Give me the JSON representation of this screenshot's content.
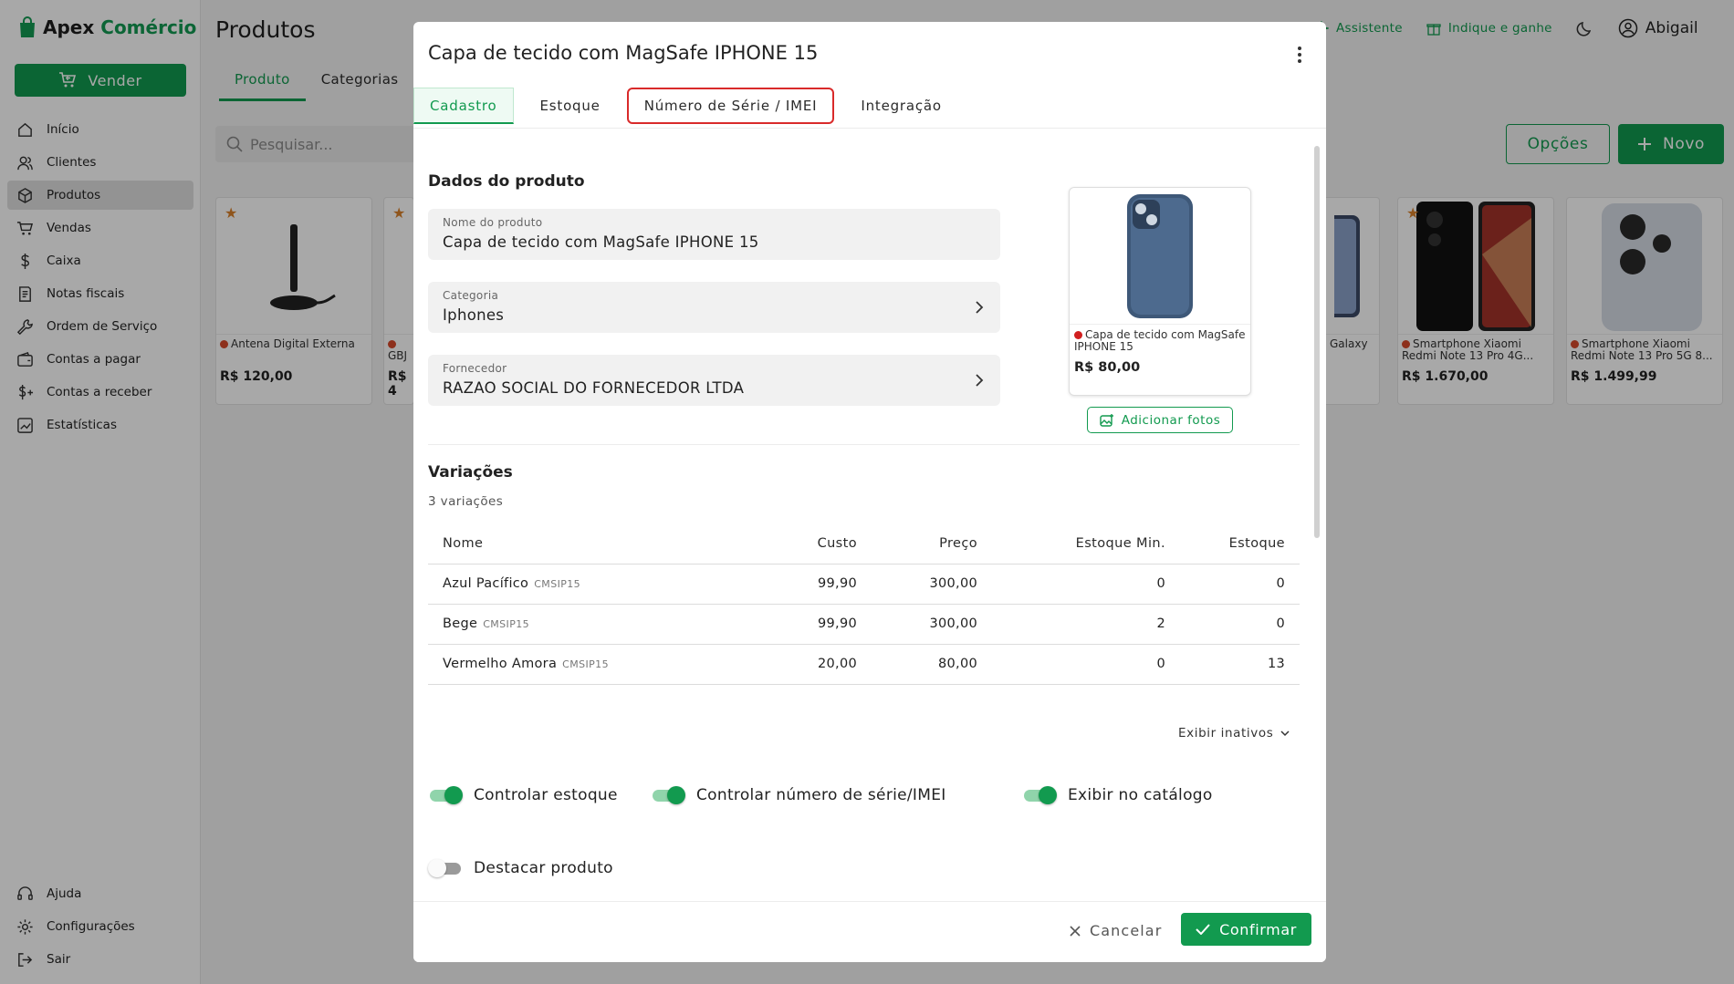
{
  "app": {
    "brand_part1": "Apex",
    "brand_part2": "Comércio",
    "sell_label": "Vender"
  },
  "sidebar": {
    "items": [
      {
        "label": "Início",
        "icon": "home-icon"
      },
      {
        "label": "Clientes",
        "icon": "users-icon"
      },
      {
        "label": "Produtos",
        "icon": "box-icon",
        "active": true
      },
      {
        "label": "Vendas",
        "icon": "cart-icon"
      },
      {
        "label": "Caixa",
        "icon": "dollar-icon"
      },
      {
        "label": "Notas fiscais",
        "icon": "receipt-icon"
      },
      {
        "label": "Ordem de Serviço",
        "icon": "wrench-icon"
      },
      {
        "label": "Contas a pagar",
        "icon": "wallet-icon"
      },
      {
        "label": "Contas a receber",
        "icon": "dollar-plus-icon"
      },
      {
        "label": "Estatísticas",
        "icon": "chart-icon"
      }
    ],
    "bottom": [
      {
        "label": "Ajuda",
        "icon": "headset-icon"
      },
      {
        "label": "Configurações",
        "icon": "gear-icon"
      },
      {
        "label": "Sair",
        "icon": "logout-icon"
      }
    ]
  },
  "header": {
    "title": "Produtos",
    "tabs": [
      "Produto",
      "Categorias"
    ],
    "search_placeholder": "Pesquisar...",
    "assistant": "Assistente",
    "refer": "Indique e ganhe",
    "user": "Abigail",
    "options": "Opções",
    "new": "Novo"
  },
  "products": [
    {
      "name": "Antena Digital Externa",
      "price": "R$ 120,00"
    },
    {
      "name": "GBJ",
      "price": "R$ 4"
    },
    {
      "name": "Galaxy",
      "price": ""
    },
    {
      "name": "Smartphone Xiaomi Redmi Note 13 Pro 4G...",
      "price": "R$ 1.670,00"
    },
    {
      "name": "Smartphone Xiaomi Redmi Note 13 Pro 5G 8...",
      "price": "R$ 1.499,99"
    }
  ],
  "modal": {
    "title": "Capa de tecido com MagSafe IPHONE 15",
    "tabs": [
      {
        "label": "Cadastro",
        "active": true
      },
      {
        "label": "Estoque"
      },
      {
        "label": "Número de Série / IMEI",
        "highlighted": true
      },
      {
        "label": "Integração"
      }
    ],
    "section_product": "Dados do produto",
    "fields": {
      "name": {
        "label": "Nome do produto",
        "value": "Capa de tecido com MagSafe IPHONE 15"
      },
      "category": {
        "label": "Categoria",
        "value": "Iphones"
      },
      "supplier": {
        "label": "Fornecedor",
        "value": "RAZAO SOCIAL DO FORNECEDOR LTDA"
      }
    },
    "preview": {
      "name": "Capa de tecido com MagSafe IPHONE 15",
      "price": "R$ 80,00"
    },
    "add_photos": "Adicionar fotos",
    "section_variations": "Variações",
    "variation_count": "3 variações",
    "table": {
      "headers": [
        "Nome",
        "Custo",
        "Preço",
        "Estoque Min.",
        "Estoque"
      ],
      "rows": [
        {
          "name": "Azul Pacífico",
          "sku": "CMSIP15",
          "cost": "99,90",
          "price": "300,00",
          "min": "0",
          "stock": "0",
          "stock_alert": true
        },
        {
          "name": "Bege",
          "sku": "CMSIP15",
          "cost": "99,90",
          "price": "300,00",
          "min": "2",
          "stock": "0",
          "stock_alert": true
        },
        {
          "name": "Vermelho Amora",
          "sku": "CMSIP15",
          "cost": "20,00",
          "price": "80,00",
          "min": "0",
          "stock": "13",
          "stock_alert": false
        }
      ]
    },
    "show_inactive": "Exibir inativos",
    "toggles": {
      "stock": {
        "label": "Controlar estoque",
        "on": true
      },
      "serial": {
        "label": "Controlar número de série/IMEI",
        "on": true
      },
      "catalog": {
        "label": "Exibir no catálogo",
        "on": true
      },
      "featured": {
        "label": "Destacar produto",
        "on": false
      }
    },
    "cancel": "Cancelar",
    "confirm": "Confirmar"
  },
  "colors": {
    "accent": "#129a4f",
    "alert": "#c0392b",
    "highlight_border": "#d92a2a"
  }
}
